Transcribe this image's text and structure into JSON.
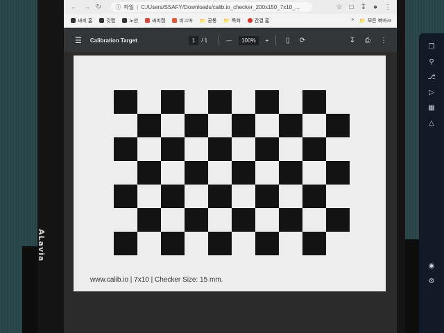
{
  "browser": {
    "url_prefix": "파일",
    "url": "C:/Users/SSAFY/Downloads/calib.io_checker_200x150_7x10_...",
    "bookmarks": [
      "싸피 홈",
      "깃랩",
      "노션",
      "싸피캠",
      "피그마",
      "공통",
      "특화",
      "간결 홈"
    ],
    "bookmarks_all": "모든 북마크"
  },
  "pdf": {
    "title": "Calibration Target",
    "page_current": "1",
    "page_total": "/ 1",
    "zoom": "100%",
    "zoom_minus": "—",
    "zoom_plus": "+"
  },
  "document": {
    "caption": "www.calib.io | 7x10 | Checker Size: 15 mm.",
    "board_rows": 7,
    "board_cols": 10
  },
  "monitor": {
    "brand": "ALavia"
  },
  "colors": {
    "toolbar_bg": "#323639",
    "page_bg": "#ededed",
    "checker": "#131313"
  }
}
